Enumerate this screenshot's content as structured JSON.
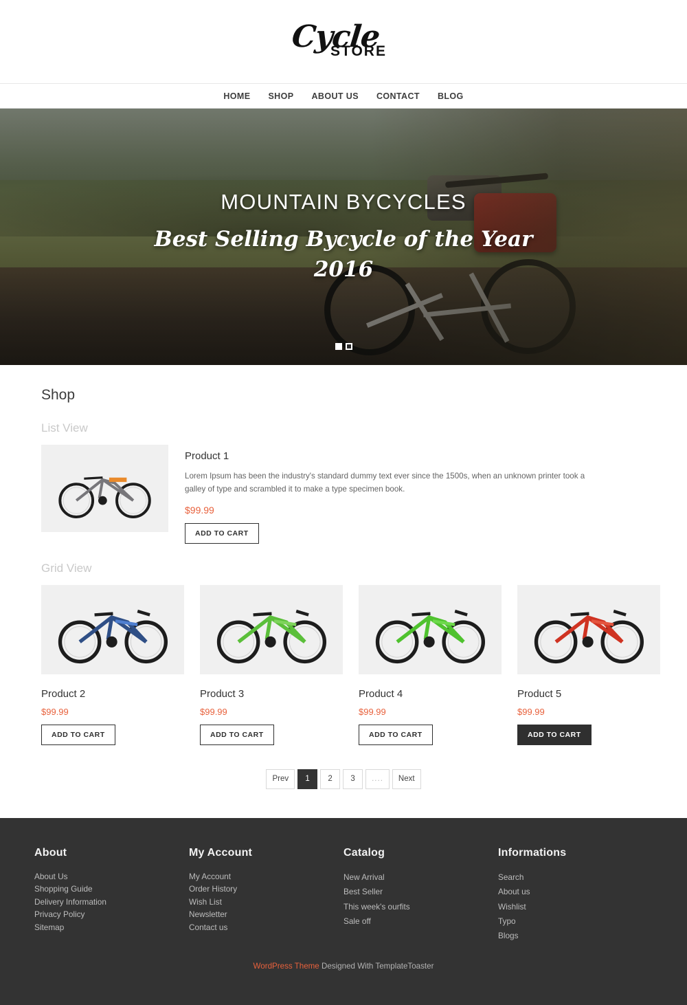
{
  "header": {
    "logo_script": "Cycle",
    "logo_store": "STORE"
  },
  "nav": {
    "items": [
      {
        "label": "HOME"
      },
      {
        "label": "SHOP"
      },
      {
        "label": "ABOUT US"
      },
      {
        "label": "CONTACT"
      },
      {
        "label": "BLOG"
      }
    ]
  },
  "hero": {
    "title": "MOUNTAIN BYCYCLES",
    "subtitle": "Best Selling Bycycle of the Year 2016",
    "dots": [
      "slide-1",
      "slide-2"
    ]
  },
  "shop": {
    "title": "Shop",
    "list_view_label": "List View",
    "grid_view_label": "Grid View",
    "list_product": {
      "name": "Product 1",
      "description": "Lorem Ipsum has been the industry's standard dummy text ever since the 1500s, when an unknown printer took a galley of type and scrambled it to make a type specimen book.",
      "price": "$99.99",
      "add_to_cart": "ADD TO CART",
      "image_alt": "gray-orange-folding-bicycle"
    },
    "grid_products": [
      {
        "name": "Product 2",
        "price": "$99.99",
        "add_to_cart": "ADD TO CART",
        "hover": false,
        "image_alt": "black-blue-hybrid-bicycle",
        "frame": "#2f4f86",
        "accent": "#4f7fd0"
      },
      {
        "name": "Product 3",
        "price": "$99.99",
        "add_to_cart": "ADD TO CART",
        "hover": false,
        "image_alt": "black-green-bicycle",
        "frame": "#5bbf3a",
        "accent": "#7fd45c"
      },
      {
        "name": "Product 4",
        "price": "$99.99",
        "add_to_cart": "ADD TO CART",
        "hover": false,
        "image_alt": "green-black-mountain-bicycle",
        "frame": "#4fc22e",
        "accent": "#6ed94c"
      },
      {
        "name": "Product 5",
        "price": "$99.99",
        "add_to_cart": "ADD TO CART",
        "hover": true,
        "image_alt": "red-black-mountain-bicycle",
        "frame": "#cf3322",
        "accent": "#e4553f"
      }
    ],
    "pagination": [
      {
        "label": "Prev",
        "state": "normal"
      },
      {
        "label": "1",
        "state": "active"
      },
      {
        "label": "2",
        "state": "normal"
      },
      {
        "label": "3",
        "state": "normal"
      },
      {
        "label": "....",
        "state": "dots"
      },
      {
        "label": "Next",
        "state": "normal"
      }
    ]
  },
  "footer": {
    "columns": [
      {
        "heading": "About",
        "wide": false,
        "links": [
          "About Us",
          "Shopping Guide",
          "Delivery Information",
          "Privacy Policy",
          "Sitemap"
        ]
      },
      {
        "heading": "My Account",
        "wide": false,
        "links": [
          "My Account",
          "Order History",
          "Wish List",
          "Newsletter",
          "Contact us"
        ]
      },
      {
        "heading": "Catalog",
        "wide": true,
        "links": [
          "New Arrival",
          "Best Seller",
          "This week's ourfits",
          "Sale off"
        ]
      },
      {
        "heading": "Informations",
        "wide": true,
        "links": [
          "Search",
          "About us",
          "Wishlist",
          "Typo",
          "Blogs"
        ]
      }
    ],
    "credit_link": "WordPress Theme",
    "credit_rest": " Designed With TemplateToaster"
  },
  "colors": {
    "accent": "#e8613c",
    "footer_bg": "#333333",
    "thumb_bg": "#f0f0f0",
    "text_dark": "#333333"
  }
}
